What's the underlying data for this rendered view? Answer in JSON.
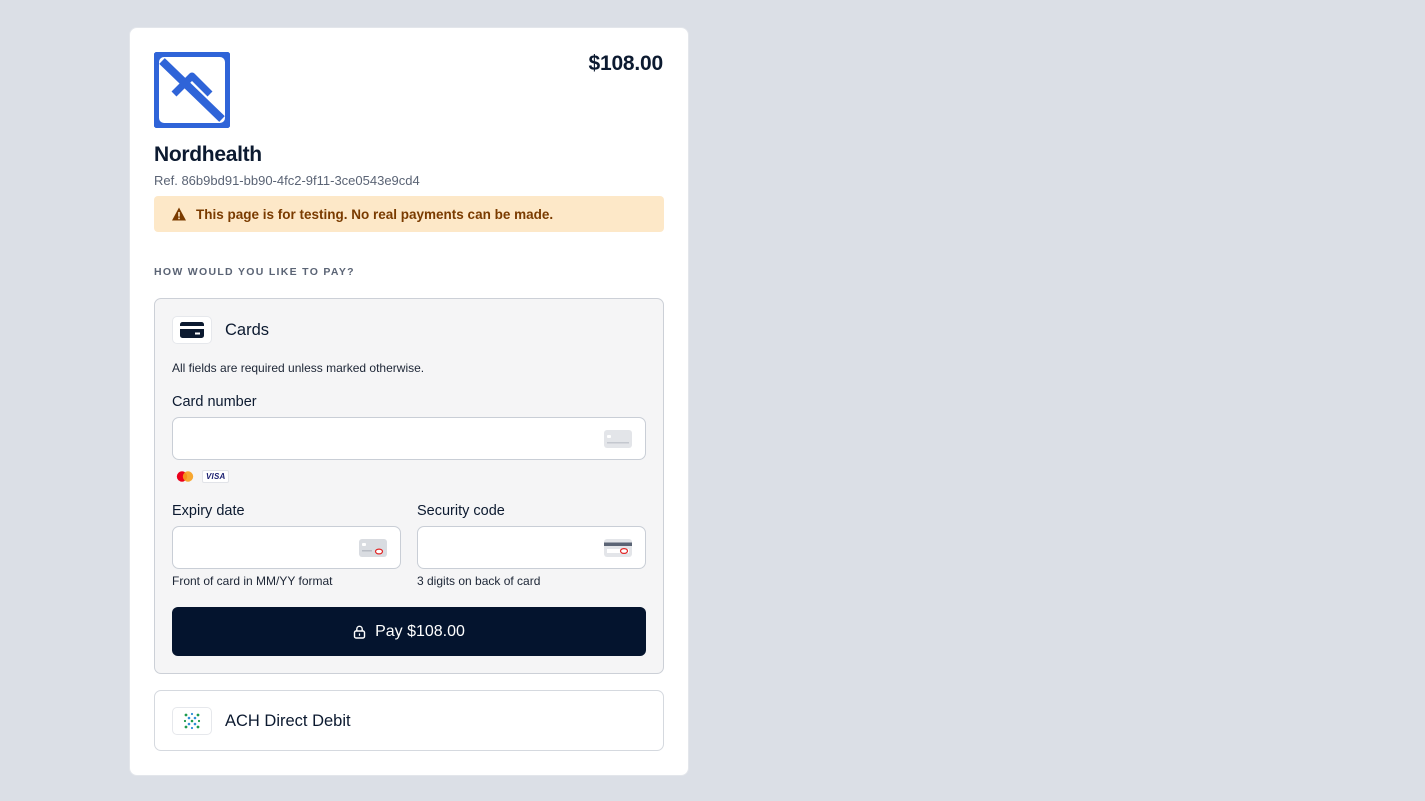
{
  "checkout": {
    "amount": "$108.00",
    "merchant_name": "Nordhealth",
    "reference": "Ref. 86b9bd91-bb90-4fc2-9f11-3ce0543e9cd4",
    "test_notice": "This page is for testing. No real payments can be made.",
    "section_label": "HOW WOULD YOU LIKE TO PAY?"
  },
  "cards_method": {
    "title": "Cards",
    "required_note": "All fields are required unless marked otherwise.",
    "card_number_label": "Card number",
    "card_number_value": "",
    "brands": [
      "mastercard-icon",
      "VISA"
    ],
    "visa_label": "VISA",
    "expiry_label": "Expiry date",
    "expiry_value": "",
    "expiry_hint": "Front of card in MM/YY format",
    "security_label": "Security code",
    "security_value": "",
    "security_hint": "3 digits on back of card",
    "pay_button_label": "Pay $108.00"
  },
  "ach_method": {
    "title": "ACH Direct Debit"
  },
  "colors": {
    "background": "#dbdfe6",
    "brand_blue": "#2f64d8",
    "pay_button": "#04142e",
    "warning_bg": "#fde8c8",
    "warning_text": "#7a3b00"
  }
}
